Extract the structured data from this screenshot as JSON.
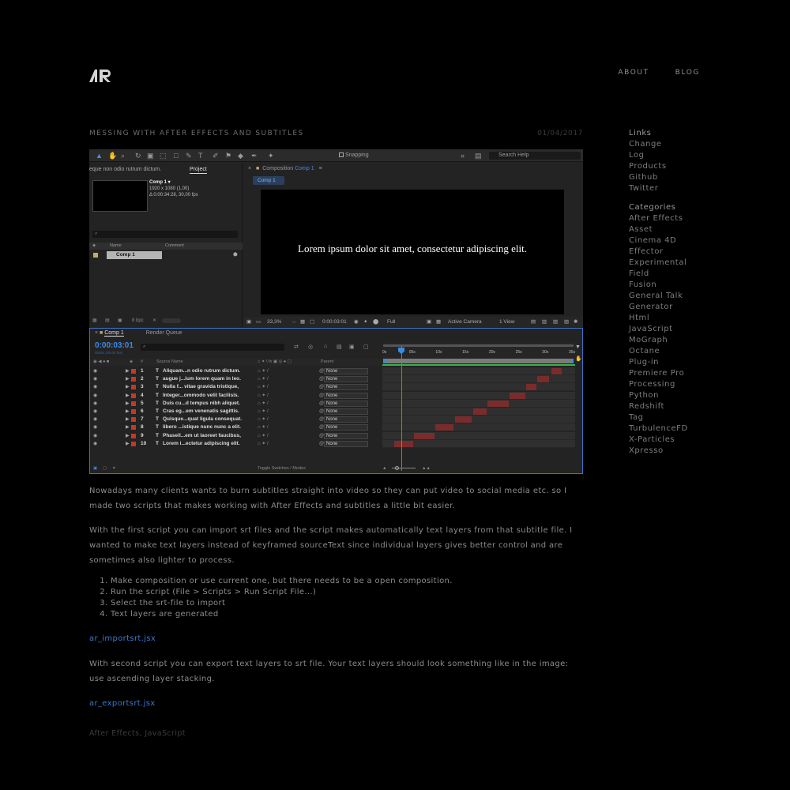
{
  "header": {
    "logo_alt": "AR",
    "nav": [
      {
        "label": "ABOUT"
      },
      {
        "label": "BLOG"
      }
    ]
  },
  "post": {
    "title": "MESSING WITH AFTER EFFECTS AND SUBTITLES",
    "date": "01/04/2017",
    "paragraph1": "Nowadays many clients wants to burn subtitles straight into video so they can put video to social media etc. so I made two scripts that makes working with After Effects and subtitles a little bit easier.",
    "paragraph2": "With the first script you can import srt files and the script makes automatically text layers from that subtitle file. I wanted to make text layers instead of keyframed sourceText since individual layers gives better control and are sometimes also lighter to process.",
    "steps": [
      "Make composition or use current one, but there needs to be a open composition.",
      "Run the script (File > Scripts > Run Script File...)",
      "Select the srt-file to import",
      "Text layers are generated"
    ],
    "link1": "ar_importsrt.jsx",
    "paragraph3": "With second script you can export text layers to srt file. Your text layers should look something like in the image: use ascending layer stacking.",
    "link2": "ar_exportsrt.jsx",
    "tags": [
      "After Effects",
      "JavaScript"
    ],
    "tag_separator": ", "
  },
  "sidebar": {
    "links_heading": "Links",
    "links": [
      "Change Log",
      "Products",
      "Github",
      "Twitter"
    ],
    "categories_heading": "Categories",
    "categories": [
      "After Effects",
      "Asset",
      "Cinema 4D",
      "Effector",
      "Experimental",
      "Field",
      "Fusion",
      "General Talk",
      "Generator",
      "Html",
      "JavaScript",
      "MoGraph",
      "Octane",
      "Plug-in",
      "Premiere Pro",
      "Processing",
      "Python",
      "Redshift",
      "Tag",
      "TurbulenceFD",
      "X-Particles",
      "Xpresso"
    ]
  },
  "screenshot": {
    "toolbar": {
      "snapping": "Snapping",
      "search_help": "Search Help"
    },
    "project_panel": {
      "cut_text": "eque non odio rutrum dictum.",
      "tab": "Project",
      "comp_name": "Comp 1 ▾",
      "comp_res": "1920 x 1080 (1,00)",
      "comp_dur": "Δ 0:00:34:28, 30,00 fps",
      "col_name": "Name",
      "col_comment": "Comment",
      "item": "Comp 1",
      "bpc": "8 bpc"
    },
    "composition": {
      "tab_prefix": "Composition",
      "tab_name": "Comp 1",
      "sub_tab": "Comp 1",
      "subtitle": "Lorem ipsum dolor sit amet, consectetur adipiscing elit.",
      "zoom": "33,3%",
      "timecode": "0:00:03:01",
      "quality": "Full",
      "camera": "Active Camera",
      "view": "1 View"
    },
    "timeline": {
      "tab_comp": "Comp 1",
      "tab_render": "Render Queue",
      "timecode": "0:00:03:01",
      "fps": "00091 (30.00 fps)",
      "col_num": "#",
      "col_source": "Source Name",
      "col_parent": "Parent",
      "toggle": "Toggle Switches / Modes",
      "ticks": [
        "0s",
        "05s",
        "10s",
        "15s",
        "20s",
        "25s",
        "30s",
        "35s"
      ],
      "layers": [
        {
          "num": "1",
          "name": "Aliquam...n odio rutrum dictum.",
          "parent": "None",
          "start": 0.875,
          "end": 0.93
        },
        {
          "num": "2",
          "name": "augue j...ium lorem quam in leo.",
          "parent": "None",
          "start": 0.805,
          "end": 0.865
        },
        {
          "num": "3",
          "name": "Nulla f... vitae gravida tristique,",
          "parent": "None",
          "start": 0.745,
          "end": 0.8
        },
        {
          "num": "4",
          "name": "Integer...ommodo velit facilisis.",
          "parent": "None",
          "start": 0.66,
          "end": 0.74
        },
        {
          "num": "5",
          "name": "Duis cu...d tempus nibh aliquet.",
          "parent": "None",
          "start": 0.545,
          "end": 0.655
        },
        {
          "num": "6",
          "name": "Cras eg...em venenatis sagittis.",
          "parent": "None",
          "start": 0.47,
          "end": 0.54
        },
        {
          "num": "7",
          "name": "Quisque...quat ligula consequat.",
          "parent": "None",
          "start": 0.375,
          "end": 0.465
        },
        {
          "num": "8",
          "name": "libero ...istique nunc nunc a elit.",
          "parent": "None",
          "start": 0.275,
          "end": 0.37
        },
        {
          "num": "9",
          "name": "Phasell...em ut laoreet faucibus,",
          "parent": "None",
          "start": 0.165,
          "end": 0.27
        },
        {
          "num": "10",
          "name": "Lorem i...ectetur adipiscing elit.",
          "parent": "None",
          "start": 0.06,
          "end": 0.16
        }
      ]
    }
  }
}
